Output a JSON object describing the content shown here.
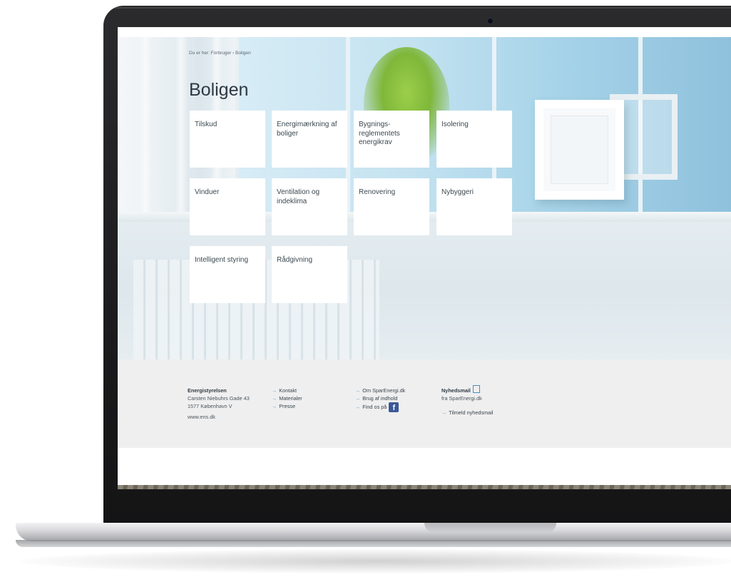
{
  "page": {
    "breadcrumb": "Du er her: Forbruger › Boligen",
    "title": "Boligen"
  },
  "tiles": [
    {
      "label": "Tilskud"
    },
    {
      "label": "Energimærkning af boliger"
    },
    {
      "label": "Bygnings-reglementets energikrav"
    },
    {
      "label": "Isolering"
    },
    {
      "label": "Vinduer"
    },
    {
      "label": "Ventilation og indeklima"
    },
    {
      "label": "Renovering"
    },
    {
      "label": "Nybyggeri"
    },
    {
      "label": "Intelligent styring"
    },
    {
      "label": "Rådgivning"
    }
  ],
  "footer": {
    "org": {
      "name": "Energistyrelsen",
      "address1": "Carsten Niebuhrs Gade 43",
      "address2": "1577 København V",
      "website": "www.ens.dk"
    },
    "col2": [
      "Kontakt",
      "Materialer",
      "Presse"
    ],
    "col3": {
      "about": "Om SparEnergi.dk",
      "usage": "Brug af indhold",
      "find_us": "Find os på",
      "facebook_glyph": "f"
    },
    "newsletter": {
      "title": "Nyhedsmail",
      "subtitle": "fra SparEnergi.dk",
      "signup": "Tilmeld nyhedsmail"
    },
    "arrow_glyph": "→"
  },
  "icons": {
    "facebook": "facebook-icon",
    "newsletter": "mail-icon"
  },
  "colors": {
    "tile_bg": "#ffffff",
    "footer_bg": "#efeff0",
    "facebook_blue": "#3b5998",
    "link_arrow": "#6aa9c9"
  }
}
